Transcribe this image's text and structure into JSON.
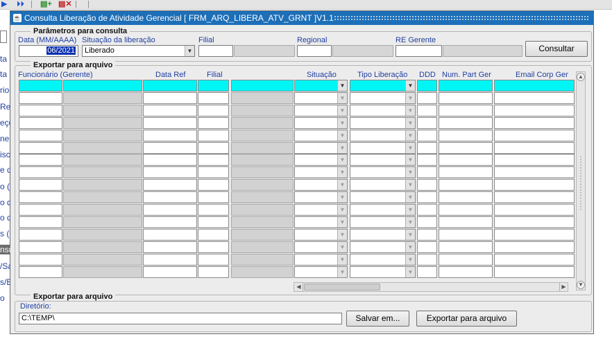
{
  "window": {
    "title": "Consulta Liberação de Atividade Gerencial [ FRM_ARQ_LIBERA_ATV_GRNT ]V1.1",
    "icon": "forms-icon"
  },
  "background_labels": [
    "ta",
    "ta",
    "rio",
    "Re",
    "eçõ",
    "ne",
    "isc",
    "e d",
    "o (",
    "o d",
    "o d",
    "s (",
    "nsu",
    "/Sa",
    "s/E",
    "o"
  ],
  "params": {
    "legend": "Parâmetros para consulta",
    "date_label": "Data (MM/AAAA)",
    "date_value": "06/2021",
    "situacao_label": "Situação da liberação",
    "situacao_value": "Liberado",
    "filial_label": "Filial",
    "regional_label": "Regional",
    "re_gerente_label": "RE Gerente",
    "consultar_label": "Consultar"
  },
  "grid": {
    "legend": "Exportar para arquivo",
    "columns": {
      "funcionario": "Funcionário (Gerente)",
      "data_ref": "Data Ref",
      "filial": "Filial",
      "situacao": "Situação",
      "tipo_liberacao": "Tipo Liberação",
      "ddd": "DDD",
      "num_part": "Num. Part Ger",
      "email": "Email Corp Ger"
    },
    "row_count": 16
  },
  "export": {
    "legend": "Exportar para arquivo",
    "dir_label": "Diretório:",
    "dir_value": "C:\\TEMP\\",
    "salvar_label": "Salvar em...",
    "exportar_label": "Exportar para arquivo"
  },
  "colors": {
    "title_bar": "#1d6fb8",
    "highlight_row": "#00f5f5",
    "label_text": "#1f3ea0",
    "disabled_field": "#d2d2d2"
  }
}
